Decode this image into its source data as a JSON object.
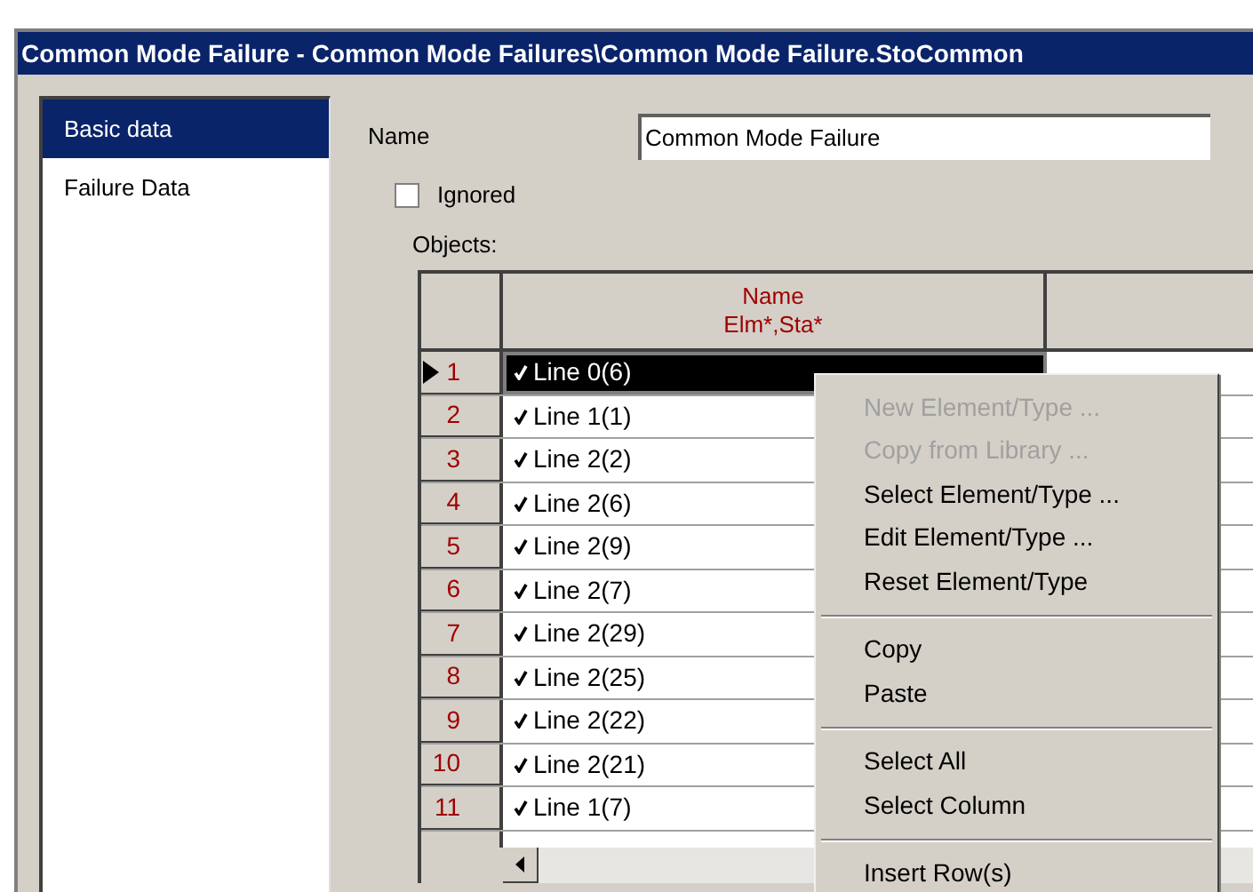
{
  "window": {
    "title": "Common Mode Failure - Common Mode Failures\\Common Mode Failure.StoCommon"
  },
  "sidebar": {
    "items": [
      {
        "label": "Basic data",
        "selected": true
      },
      {
        "label": "Failure Data",
        "selected": false
      }
    ]
  },
  "name_field": {
    "label": "Name",
    "value": "Common Mode Failure"
  },
  "ignored": {
    "label": "Ignored",
    "checked": false
  },
  "objects": {
    "label": "Objects:",
    "columns": [
      "Name\nElm*,Sta*"
    ],
    "rows": [
      {
        "number": "1",
        "name": "Line 0(6)",
        "selected": true
      },
      {
        "number": "2",
        "name": "Line 1(1)",
        "selected": false
      },
      {
        "number": "3",
        "name": "Line 2(2)",
        "selected": false
      },
      {
        "number": "4",
        "name": "Line 2(6)",
        "selected": false
      },
      {
        "number": "5",
        "name": "Line 2(9)",
        "selected": false
      },
      {
        "number": "6",
        "name": "Line 2(7)",
        "selected": false
      },
      {
        "number": "7",
        "name": "Line 2(29)",
        "selected": false
      },
      {
        "number": "8",
        "name": "Line 2(25)",
        "selected": false
      },
      {
        "number": "9",
        "name": "Line 2(22)",
        "selected": false
      },
      {
        "number": "10",
        "name": "Line 2(21)",
        "selected": false
      },
      {
        "number": "11",
        "name": "Line 1(7)",
        "selected": false
      }
    ]
  },
  "context_menu": {
    "items": [
      {
        "kind": "item",
        "label": "New Element/Type ...",
        "disabled": true
      },
      {
        "kind": "item",
        "label": "Copy from Library ...",
        "disabled": true
      },
      {
        "kind": "item",
        "label": "Select Element/Type ...",
        "disabled": false
      },
      {
        "kind": "item",
        "label": "Edit Element/Type ...",
        "disabled": false
      },
      {
        "kind": "item",
        "label": "Reset Element/Type",
        "disabled": false
      },
      {
        "kind": "separator"
      },
      {
        "kind": "item",
        "label": "Copy",
        "disabled": false
      },
      {
        "kind": "item",
        "label": "Paste",
        "disabled": false
      },
      {
        "kind": "separator"
      },
      {
        "kind": "item",
        "label": "Select All",
        "disabled": false
      },
      {
        "kind": "item",
        "label": "Select Column",
        "disabled": false
      },
      {
        "kind": "separator"
      },
      {
        "kind": "item",
        "label": "Insert Row(s)",
        "disabled": false
      }
    ]
  }
}
